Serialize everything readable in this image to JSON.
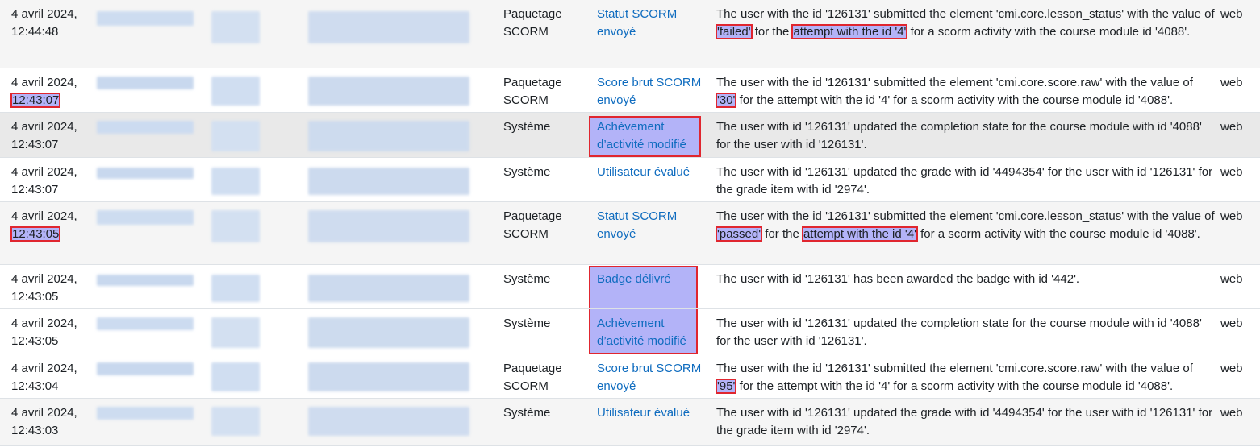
{
  "rows": [
    {
      "date": "4 avril 2024,",
      "time": "12:44:48",
      "origin": "Paquetage SCORM",
      "event": "Statut SCORM envoyé",
      "source": "web",
      "desc": {
        "a": "The user with the id '126131' submitted the element 'cmi.core.lesson_status' with the value of ",
        "b": "'failed'",
        "c": " for the ",
        "d": "attempt with the id '4'",
        "e": " for a scorm activity with the course module id '4088'."
      }
    },
    {
      "date": "4 avril 2024,",
      "time": "12:43:07",
      "origin": "Paquetage SCORM",
      "event": "Score brut SCORM envoyé",
      "source": "web",
      "desc": {
        "a": "The user with the id '126131' submitted the element 'cmi.core.score.raw' with the value of ",
        "b": "'30'",
        "c": " for the attempt with the id '4' for a scorm activity with the course module id '4088'."
      }
    },
    {
      "date": "4 avril 2024,",
      "time": "12:43:07",
      "origin": "Système",
      "event": "Achèvement d’activité modifié",
      "source": "web",
      "desc": "The user with id '126131' updated the completion state for the course module with id '4088' for the user with id '126131'."
    },
    {
      "date": "4 avril 2024,",
      "time": "12:43:07",
      "origin": "Système",
      "event": "Utilisateur évalué",
      "source": "web",
      "desc": "The user with id '126131' updated the grade with id '4494354' for the user with id '126131' for the grade item with id '2974'."
    },
    {
      "date": "4 avril 2024,",
      "time": "12:43:05",
      "origin": "Paquetage SCORM",
      "event": "Statut SCORM envoyé",
      "source": "web",
      "desc": {
        "a": "The user with the id '126131' submitted the element 'cmi.core.lesson_status' with the value of ",
        "b": "'passed'",
        "c": " for the ",
        "d": "attempt with the id '4'",
        "e": " for a scorm activity with the course module id '4088'."
      }
    },
    {
      "date": "4 avril 2024,",
      "time": "12:43:05",
      "origin": "Système",
      "event": "Badge délivré",
      "source": "web",
      "desc": "The user with id '126131' has been awarded the badge with id '442'."
    },
    {
      "date": "4 avril 2024,",
      "time": "12:43:05",
      "origin": "Système",
      "event": "Achèvement d’activité modifié",
      "source": "web",
      "desc": "The user with id '126131' updated the completion state for the course module with id '4088' for the user with id '126131'."
    },
    {
      "date": "4 avril 2024,",
      "time": "12:43:04",
      "origin": "Paquetage SCORM",
      "event": "Score brut SCORM envoyé",
      "source": "web",
      "desc": {
        "a": "The user with the id '126131' submitted the element 'cmi.core.score.raw' with the value of ",
        "b": "'95'",
        "c": " for the attempt with the id '4' for a scorm activity with the course module id '4088'."
      }
    },
    {
      "date": "4 avril 2024,",
      "time": "12:43:03",
      "origin": "Système",
      "event": "Utilisateur évalué",
      "source": "web",
      "desc": "The user with id '126131' updated the grade with id '4494354' for the user with id '126131' for the grade item with id '2974'."
    }
  ],
  "colors": {
    "highlight": "#b3b3f8",
    "annotation_border": "#e0262f",
    "link": "#0f6cbf",
    "redacted": "#c9d9ef"
  }
}
